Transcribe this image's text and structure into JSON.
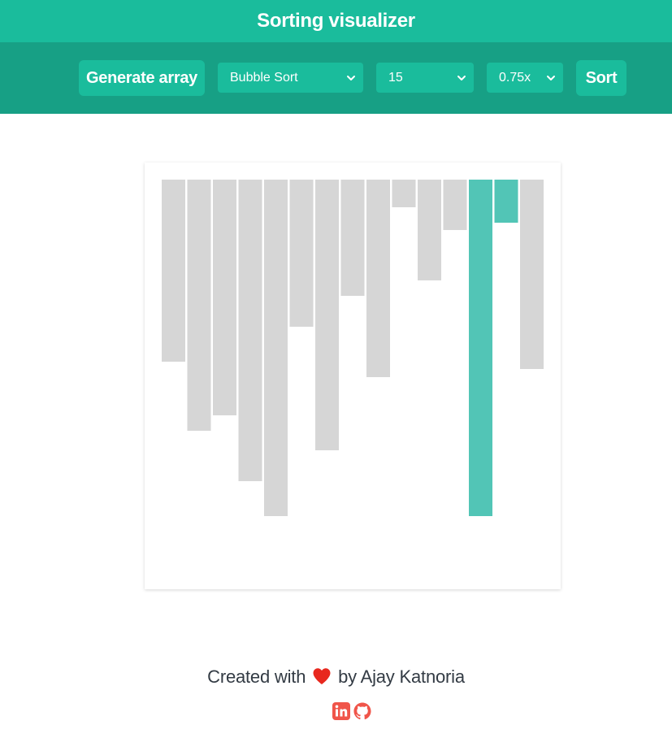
{
  "header": {
    "title": "Sorting visualizer"
  },
  "toolbar": {
    "generate_label": "Generate array",
    "algorithm_selected": "Bubble Sort",
    "size_selected": "15",
    "speed_selected": "0.75x",
    "sort_label": "Sort"
  },
  "colors": {
    "primary": "#1ABC9C",
    "primary_dark": "#17A085",
    "bar_default": "#D6D6D6",
    "bar_active": "#52C5B6",
    "heart": "#E8281E",
    "social": "#F0554A"
  },
  "chart_data": {
    "type": "bar",
    "orientation": "top-down",
    "values": [
      224,
      309,
      290,
      371,
      414,
      181,
      333,
      143,
      243,
      34,
      124,
      62,
      414,
      53,
      233
    ],
    "active_indices": [
      12,
      13
    ],
    "ylim": [
      0,
      500
    ]
  },
  "footer": {
    "created_prefix": "Created with",
    "created_suffix": "by Ajay Katnoria",
    "icons": [
      "heart-icon",
      "linkedin-icon",
      "github-icon"
    ]
  }
}
